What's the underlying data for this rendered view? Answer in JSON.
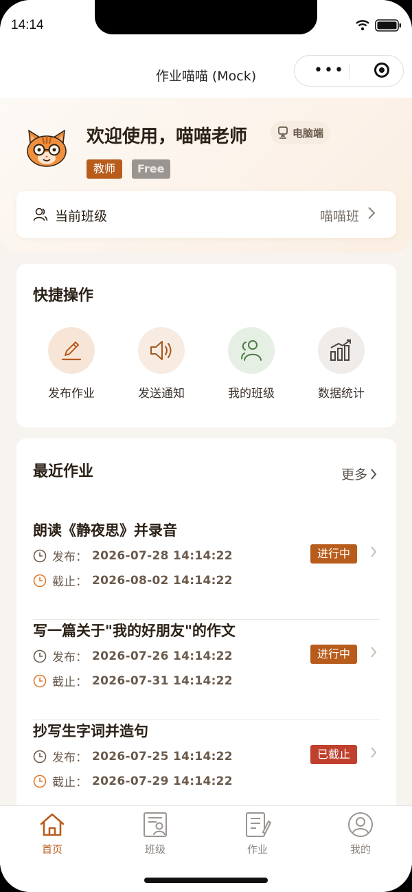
{
  "status_bar": {
    "time": "14:14"
  },
  "nav": {
    "title": "作业喵喵 (Mock)"
  },
  "header": {
    "greeting": "欢迎使用，喵喵老师",
    "device_badge": "电脑端",
    "role_tag": "教师",
    "plan_tag": "Free",
    "current_class_label": "当前班级",
    "current_class_value": "喵喵班"
  },
  "quick_actions": {
    "title": "快捷操作",
    "items": [
      {
        "label": "发布作业",
        "icon": "edit-pen-icon"
      },
      {
        "label": "发送通知",
        "icon": "speaker-icon"
      },
      {
        "label": "我的班级",
        "icon": "users-icon"
      },
      {
        "label": "数据统计",
        "icon": "bar-chart-icon"
      }
    ]
  },
  "recent": {
    "title": "最近作业",
    "more_label": "更多",
    "publish_label": "发布：",
    "deadline_label": "截止：",
    "items": [
      {
        "title": "朗读《静夜思》并录音",
        "published": "2026-07-28 14:14:22",
        "deadline": "2026-08-02 14:14:22",
        "status": "进行中"
      },
      {
        "title": "写一篇关于\"我的好朋友\"的作文",
        "published": "2026-07-26 14:14:22",
        "deadline": "2026-07-31 14:14:22",
        "status": "进行中"
      },
      {
        "title": "抄写生字词并造句",
        "published": "2026-07-25 14:14:22",
        "deadline": "2026-07-29 14:14:22",
        "status": "已截止"
      }
    ]
  },
  "tabs": [
    {
      "label": "首页",
      "icon": "home-icon",
      "active": true
    },
    {
      "label": "班级",
      "icon": "class-icon",
      "active": false
    },
    {
      "label": "作业",
      "icon": "homework-icon",
      "active": false
    },
    {
      "label": "我的",
      "icon": "profile-icon",
      "active": false
    }
  ],
  "colors": {
    "accent": "#b85c1c",
    "active_status": "#b85c1c",
    "closed_status": "#c0402e",
    "background": "#f7f3ef"
  }
}
